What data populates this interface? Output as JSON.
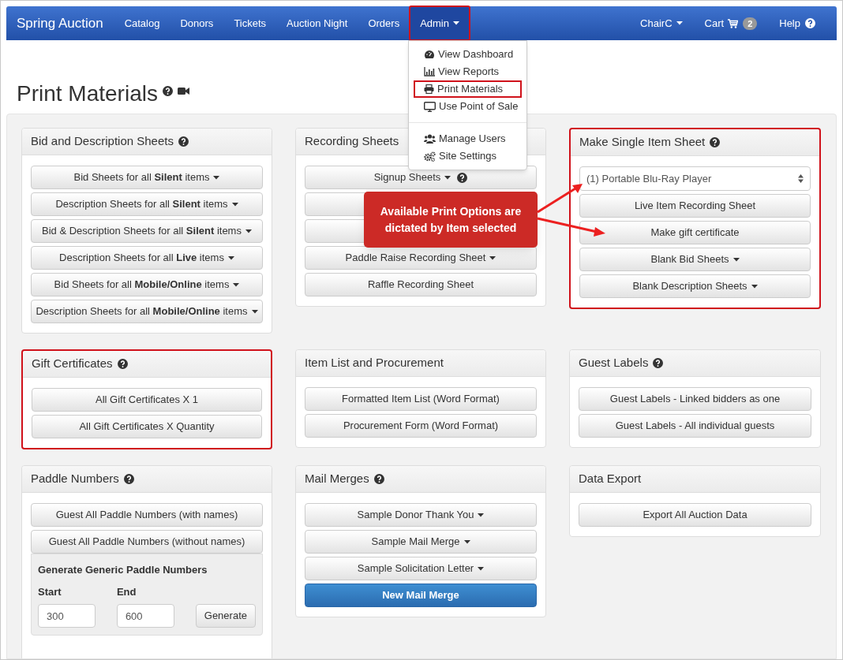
{
  "navbar": {
    "brand": "Spring Auction",
    "left": [
      {
        "label": "Catalog",
        "active": false,
        "caret": false,
        "annotated": false
      },
      {
        "label": "Donors",
        "active": false,
        "caret": false,
        "annotated": false
      },
      {
        "label": "Tickets",
        "active": false,
        "caret": false,
        "annotated": false
      },
      {
        "label": "Auction Night",
        "active": false,
        "caret": false,
        "annotated": false
      },
      {
        "label": "Orders",
        "active": false,
        "caret": false,
        "annotated": false
      },
      {
        "label": "Admin",
        "active": true,
        "caret": true,
        "annotated": true
      }
    ],
    "right": [
      {
        "kind": "menu",
        "label": "ChairC"
      },
      {
        "kind": "cart",
        "label": "Cart",
        "badge": "2"
      },
      {
        "kind": "help",
        "label": "Help"
      }
    ]
  },
  "admin_menu": [
    [
      {
        "kind": "dashboard",
        "label": "View Dashboard",
        "annotated": false
      },
      {
        "kind": "chart",
        "label": "View Reports",
        "annotated": false
      },
      {
        "kind": "print",
        "label": "Print Materials",
        "annotated": true
      },
      {
        "kind": "desktop",
        "label": "Use Point of Sale",
        "annotated": false
      }
    ],
    [
      {
        "kind": "users",
        "label": "Manage Users",
        "annotated": false
      },
      {
        "kind": "cogs",
        "label": "Site Settings",
        "annotated": false
      }
    ]
  ],
  "page_title": "Print Materials",
  "panels": [
    {
      "title": "Bid and Description Sheets",
      "help": true,
      "highlighted": false,
      "items": [
        {
          "kind": "button",
          "label": "Bid Sheets for all **Silent** items",
          "caret": true
        },
        {
          "kind": "button",
          "label": "Description Sheets for all **Silent** items",
          "caret": true
        },
        {
          "kind": "button",
          "label": "Bid & Description Sheets for all **Silent** items",
          "caret": true
        },
        {
          "kind": "button",
          "label": "Description Sheets for all **Live** items",
          "caret": true
        },
        {
          "kind": "button",
          "label": "Bid Sheets for all **Mobile/Online** items",
          "caret": true
        },
        {
          "kind": "button",
          "label": "Description Sheets for all **Mobile/Online** items",
          "caret": true
        }
      ]
    },
    {
      "title": "Recording Sheets",
      "help": false,
      "highlighted": false,
      "items": [
        {
          "kind": "button",
          "label": "Signup Sheets",
          "caret": true,
          "help": true
        },
        {
          "kind": "button"
        },
        {
          "kind": "button"
        },
        {
          "kind": "button",
          "label": "Paddle Raise Recording Sheet",
          "caret": true
        },
        {
          "kind": "button",
          "label": "Raffle Recording Sheet",
          "caret": false
        }
      ]
    },
    {
      "title": "Make Single Item Sheet",
      "help": true,
      "highlighted": true,
      "items": [
        {
          "kind": "select",
          "value": "(1) Portable Blu-Ray Player"
        },
        {
          "kind": "button",
          "label": "Live Item Recording Sheet",
          "caret": false
        },
        {
          "kind": "button",
          "label": "Make gift certificate",
          "caret": false
        },
        {
          "kind": "button",
          "label": "Blank Bid Sheets",
          "caret": true
        },
        {
          "kind": "button",
          "label": "Blank Description Sheets",
          "caret": true
        }
      ]
    },
    {
      "title": "Gift Certificates",
      "help": true,
      "highlighted": true,
      "items": [
        {
          "kind": "button",
          "label": "All Gift Certificates X 1",
          "caret": false
        },
        {
          "kind": "button",
          "label": "All Gift Certificates X Quantity",
          "caret": false
        }
      ]
    },
    {
      "title": "Item List and Procurement",
      "help": false,
      "highlighted": false,
      "items": [
        {
          "kind": "button",
          "label": "Formatted Item List (Word Format)",
          "caret": false
        },
        {
          "kind": "button",
          "label": "Procurement Form (Word Format)",
          "caret": false
        }
      ]
    },
    {
      "title": "Guest Labels",
      "help": true,
      "highlighted": false,
      "items": [
        {
          "kind": "button",
          "label": "Guest Labels - Linked bidders as one",
          "caret": false
        },
        {
          "kind": "button",
          "label": "Guest Labels - All individual guests",
          "caret": false
        }
      ]
    },
    {
      "title": "Paddle Numbers",
      "help": true,
      "highlighted": false,
      "items": [
        {
          "kind": "button",
          "label": "Guest All Paddle Numbers (with names)",
          "caret": false
        },
        {
          "kind": "button",
          "label": "Guest All Paddle Numbers (without names)",
          "caret": false
        },
        {
          "kind": "generator",
          "title": "Generate Generic Paddle Numbers",
          "fields": [
            {
              "label": "Start",
              "value": "300"
            },
            {
              "label": "End",
              "value": "600"
            }
          ],
          "button": "Generate"
        }
      ]
    },
    {
      "title": "Mail Merges",
      "help": true,
      "highlighted": false,
      "items": [
        {
          "kind": "button",
          "label": "Sample Donor Thank You",
          "caret": true
        },
        {
          "kind": "button",
          "label": "Sample Mail Merge",
          "caret": true
        },
        {
          "kind": "button",
          "label": "Sample Solicitation Letter",
          "caret": true
        },
        {
          "kind": "primary",
          "label": "New Mail Merge",
          "caret": false
        }
      ]
    },
    {
      "title": "Data Export",
      "help": false,
      "highlighted": false,
      "items": [
        {
          "kind": "button",
          "label": "Export All Auction Data",
          "caret": false
        }
      ]
    }
  ],
  "callout": {
    "text": "Available Print Options are dictated by Item selected"
  }
}
